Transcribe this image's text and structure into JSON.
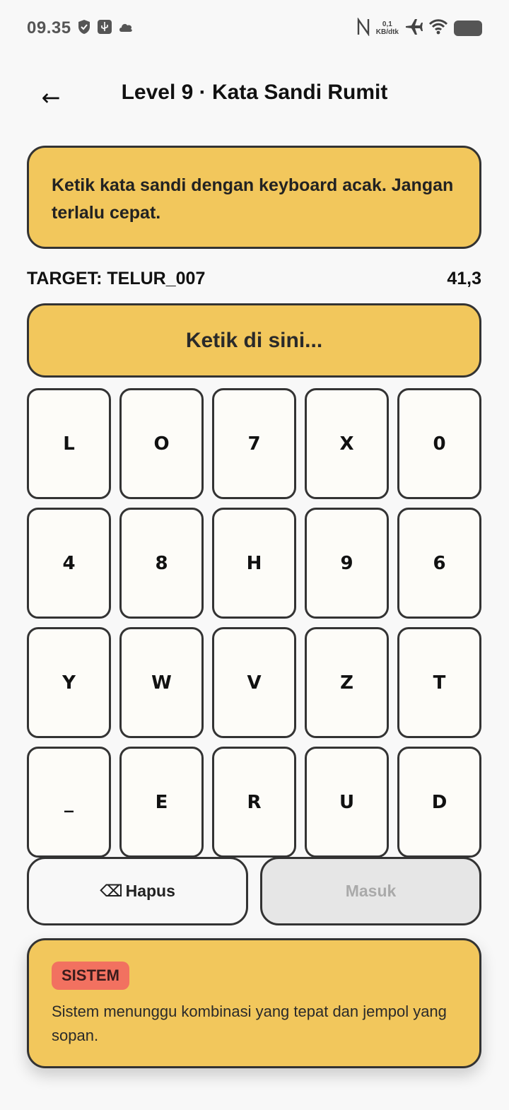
{
  "status_bar": {
    "time": "09.35",
    "speed_value": "0,1",
    "speed_unit": "KB/dtk"
  },
  "header": {
    "back_icon": "←",
    "title": "Level 9 · Kata Sandi Rumit"
  },
  "instruction": {
    "text": "Ketik kata sandi dengan keyboard acak. Jangan terlalu cepat."
  },
  "target": {
    "label": "TARGET: TELUR_007",
    "timer": "41,3"
  },
  "input": {
    "placeholder": "Ketik di sini..."
  },
  "keypad": {
    "keys": [
      "L",
      "O",
      "7",
      "X",
      "0",
      "4",
      "8",
      "H",
      "9",
      "6",
      "Y",
      "W",
      "V",
      "Z",
      "T",
      "_",
      "E",
      "R",
      "U",
      "D"
    ]
  },
  "actions": {
    "delete_icon": "⌫",
    "delete_label": "Hapus",
    "enter_label": "Masuk"
  },
  "system": {
    "badge": "SISTEM",
    "message": "Sistem menunggu kombinasi yang tepat dan jempol yang sopan."
  },
  "colors": {
    "card": "#f2c75c",
    "badge": "#f27160",
    "key_bg": "#fdfcf8",
    "disabled": "#e6e6e6"
  }
}
